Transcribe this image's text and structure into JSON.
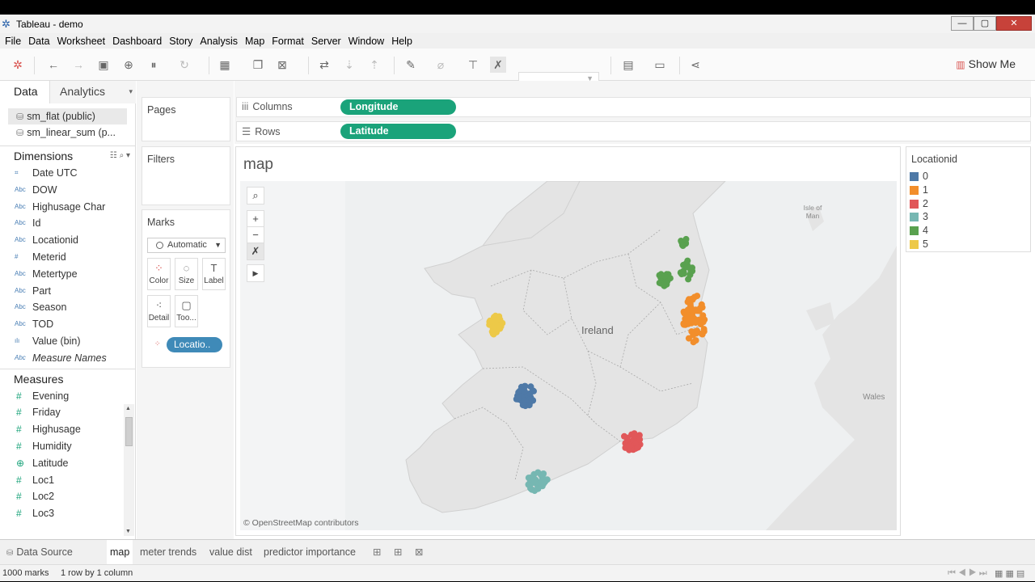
{
  "window": {
    "title": "Tableau - demo"
  },
  "menu": [
    "File",
    "Data",
    "Worksheet",
    "Dashboard",
    "Story",
    "Analysis",
    "Map",
    "Format",
    "Server",
    "Window",
    "Help"
  ],
  "toolbar": {
    "show_me_label": "Show Me"
  },
  "left_pane": {
    "tabs": {
      "data": "Data",
      "analytics": "Analytics"
    },
    "datasources": [
      "sm_flat (public)",
      "sm_linear_sum (p..."
    ],
    "dimensions_header": "Dimensions",
    "dimensions": [
      {
        "type": "date",
        "name": "Date UTC"
      },
      {
        "type": "Abc",
        "name": "DOW"
      },
      {
        "type": "Abc",
        "name": "Highusage Char"
      },
      {
        "type": "Abc",
        "name": "Id"
      },
      {
        "type": "Abc",
        "name": "Locationid"
      },
      {
        "type": "#",
        "name": "Meterid"
      },
      {
        "type": "Abc",
        "name": "Metertype"
      },
      {
        "type": "Abc",
        "name": "Part"
      },
      {
        "type": "Abc",
        "name": "Season"
      },
      {
        "type": "Abc",
        "name": "TOD"
      },
      {
        "type": "bin",
        "name": "Value (bin)"
      },
      {
        "type": "Abc",
        "name": "Measure Names"
      }
    ],
    "measures_header": "Measures",
    "measures": [
      {
        "type": "#",
        "name": "Evening"
      },
      {
        "type": "#",
        "name": "Friday"
      },
      {
        "type": "#",
        "name": "Highusage"
      },
      {
        "type": "#",
        "name": "Humidity"
      },
      {
        "type": "geo",
        "name": "Latitude"
      },
      {
        "type": "#",
        "name": "Loc1"
      },
      {
        "type": "#",
        "name": "Loc2"
      },
      {
        "type": "#",
        "name": "Loc3"
      }
    ]
  },
  "cards": {
    "pages": "Pages",
    "filters": "Filters",
    "marks": "Marks",
    "mark_type": "Automatic",
    "mark_buttons": [
      "Color",
      "Size",
      "Label",
      "Detail",
      "Too..."
    ],
    "color_pill": "Locatio.."
  },
  "shelves": {
    "columns_label": "Columns",
    "columns_pill": "Longitude",
    "rows_label": "Rows",
    "rows_pill": "Latitude"
  },
  "viz": {
    "title": "map",
    "attribution": "© OpenStreetMap contributors",
    "map_labels": {
      "country": "Ireland",
      "wales": "Wales",
      "isle": "Isle of Man"
    }
  },
  "legend": {
    "title": "Locationid",
    "items": [
      {
        "label": "0",
        "color": "#4e79a7"
      },
      {
        "label": "1",
        "color": "#f28e2b"
      },
      {
        "label": "2",
        "color": "#e15759"
      },
      {
        "label": "3",
        "color": "#76b7b2"
      },
      {
        "label": "4",
        "color": "#59a14f"
      },
      {
        "label": "5",
        "color": "#edc948"
      }
    ]
  },
  "sheets": {
    "data_source": "Data Source",
    "tabs": [
      "map",
      "meter trends",
      "value dist",
      "predictor importance"
    ]
  },
  "status": {
    "marks": "1000 marks",
    "dims": "1 row by 1 column"
  }
}
